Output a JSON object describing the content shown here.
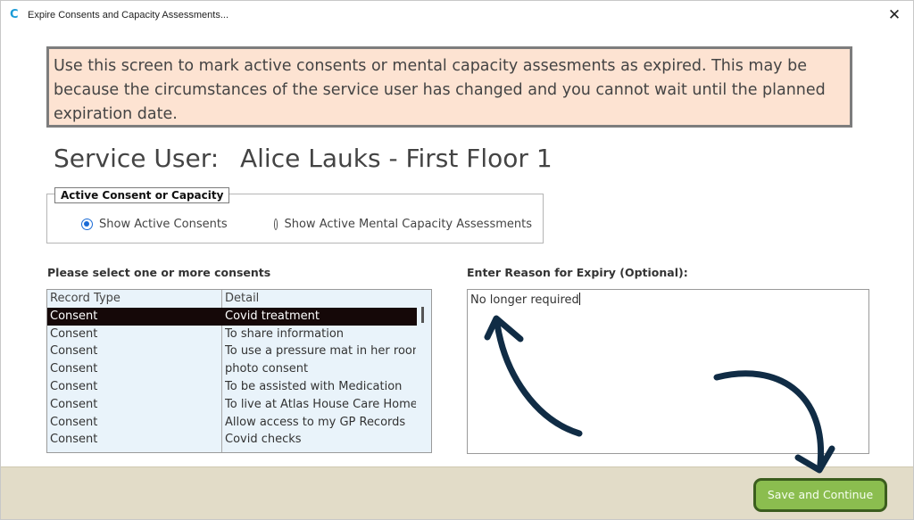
{
  "window": {
    "app_icon": "C",
    "title": "Expire Consents and Capacity Assessments...",
    "close_glyph": "✕"
  },
  "info_text": "Use this screen to mark active consents or mental capacity assesments as expired.  This may be because the circumstances of the service user has changed and you cannot wait until the planned expiration date.",
  "service_user": {
    "label": "Service User:",
    "name": "Alice Lauks - First Floor 1"
  },
  "filter": {
    "legend": "Active Consent or Capacity",
    "options": [
      {
        "label": "Show Active Consents",
        "checked": true
      },
      {
        "label": "Show Active Mental Capacity Assessments",
        "checked": false
      }
    ]
  },
  "consents": {
    "label": "Please select one or more consents",
    "columns": [
      "Record Type",
      "Detail"
    ],
    "rows": [
      {
        "type": "Consent",
        "detail": "Covid treatment",
        "selected": true
      },
      {
        "type": "Consent",
        "detail": "To share information",
        "selected": false
      },
      {
        "type": "Consent",
        "detail": "To use a pressure mat in her room",
        "selected": false
      },
      {
        "type": "Consent",
        "detail": "photo consent",
        "selected": false
      },
      {
        "type": "Consent",
        "detail": "To be assisted with Medication",
        "selected": false
      },
      {
        "type": "Consent",
        "detail": "To live at Atlas House Care Home",
        "selected": false
      },
      {
        "type": "Consent",
        "detail": "Allow access to my GP Records",
        "selected": false
      },
      {
        "type": "Consent",
        "detail": "Covid checks",
        "selected": false
      }
    ]
  },
  "reason": {
    "label": "Enter Reason for Expiry (Optional):",
    "value": "No longer required"
  },
  "footer": {
    "save_label": "Save and Continue"
  },
  "colors": {
    "info_bg": "#fde3d2",
    "selected_row": "#150808",
    "list_bg": "#e9f3fa",
    "footer_bg": "#e2dcc8",
    "save_button": "#8bbd4f",
    "annotation_arrow": "#102c45"
  }
}
